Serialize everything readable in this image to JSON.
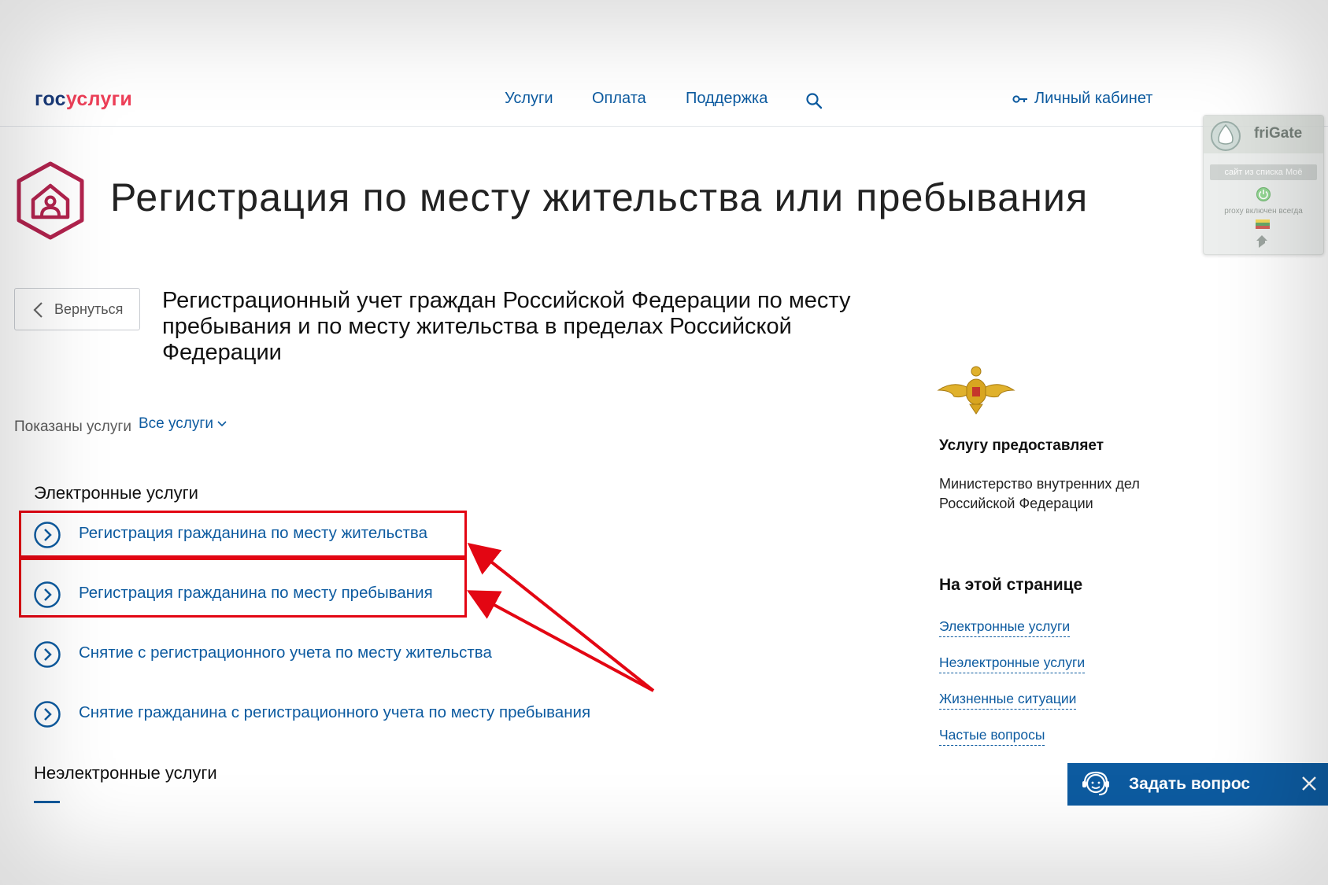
{
  "header": {
    "logo_gos": "гос",
    "logo_uslugi": "услуги",
    "nav": [
      "Услуги",
      "Оплата",
      "Поддержка"
    ],
    "cabinet_label": "Личный кабинет"
  },
  "page": {
    "title": "Регистрация по месту жительства или пребывания",
    "back_label": "Вернуться",
    "subtitle": "Регистрационный учет граждан Российской Федерации по месту пребывания и по месту жительства в пределах Российской Федерации",
    "shown_label": "Показаны услуги",
    "all_services_label": "Все услуги"
  },
  "sections": {
    "electronic_title": "Электронные услуги",
    "non_electronic_title": "Неэлектронные услуги",
    "services": [
      "Регистрация гражданина по месту жительства",
      "Регистрация гражданина по месту пребывания",
      "Снятие с регистрационного учета по месту жительства",
      "Снятие гражданина с регистрационного учета по месту пребывания"
    ]
  },
  "sidebar": {
    "provider_heading": "Услугу предоставляет",
    "provider_name": "Министерство внутренних дел Российской Федерации",
    "on_page_heading": "На этой странице",
    "anchors": [
      "Электронные услуги",
      "Неэлектронные услуги",
      "Жизненные ситуации",
      "Частые вопросы"
    ]
  },
  "frigate": {
    "name": "friGate",
    "site_button": "сайт из списка Моё",
    "proxy_status": "proxy включен всегда"
  },
  "ask_widget": {
    "label": "Задать вопрос"
  },
  "colors": {
    "link": "#0d5ba0",
    "brand_red": "#ee3f58",
    "highlight": "#e30613"
  }
}
